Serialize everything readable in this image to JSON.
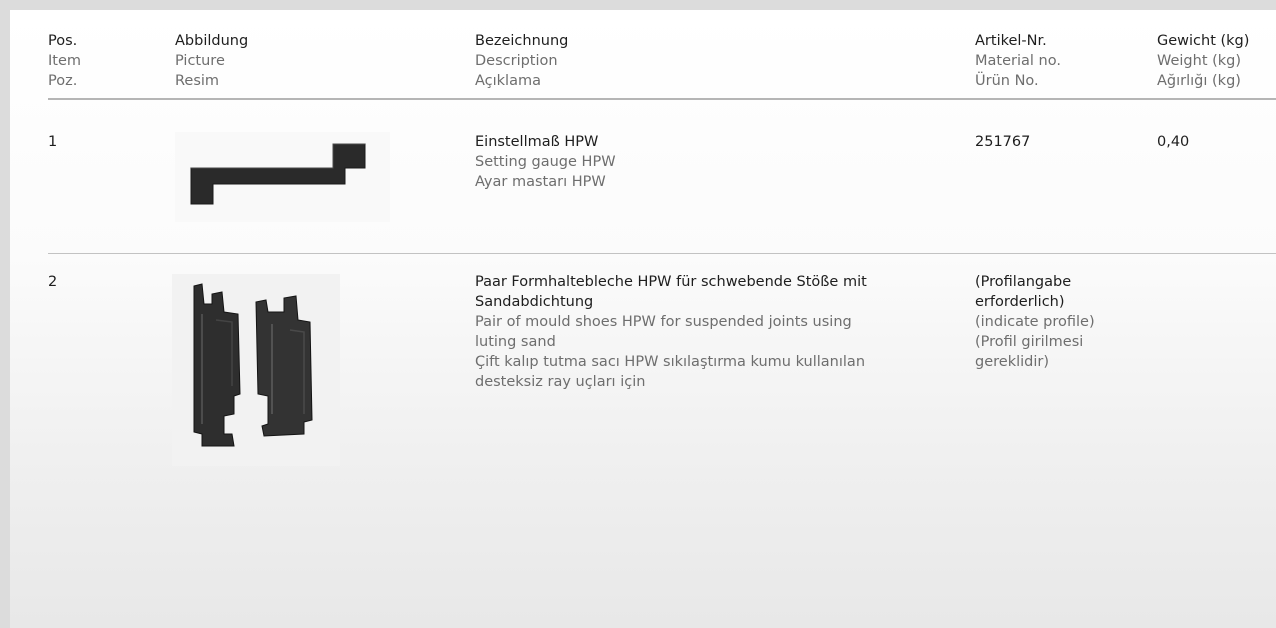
{
  "header": {
    "pos": [
      "Pos.",
      "Item",
      "Poz."
    ],
    "picture": [
      "Abbildung",
      "Picture",
      "Resim"
    ],
    "description": [
      "Bezeichnung",
      "Description",
      "Açıklama"
    ],
    "article": [
      "Artikel-Nr.",
      "Material no.",
      "Ürün No."
    ],
    "weight": [
      "Gewicht (kg)",
      "Weight (kg)",
      "Ağırlığı (kg)"
    ]
  },
  "rows": [
    {
      "pos": "1",
      "picture_icon": "setting-gauge-image",
      "description": {
        "de": "Einstellmaß HPW",
        "en": "Setting gauge HPW",
        "tr": "Ayar mastarı HPW"
      },
      "article": "251767",
      "weight": "0,40"
    },
    {
      "pos": "2",
      "picture_icon": "mould-shoes-image",
      "description": {
        "de_1": "Paar Formhaltebleche HPW für schwebende Stöße mit",
        "de_2": "Sandabdichtung",
        "en_1": "Pair of mould shoes HPW for suspended joints using",
        "en_2": "luting sand",
        "tr_1": "Çift kalıp tutma sacı HPW sıkılaştırma kumu kullanılan",
        "tr_2": "desteksiz ray uçları için"
      },
      "article": {
        "de_1": "(Profilangabe",
        "de_2": "erforderlich)",
        "en": "(indicate profile)",
        "tr_1": "(Profil girilmesi",
        "tr_2": "gereklidir)"
      },
      "weight": ""
    }
  ]
}
